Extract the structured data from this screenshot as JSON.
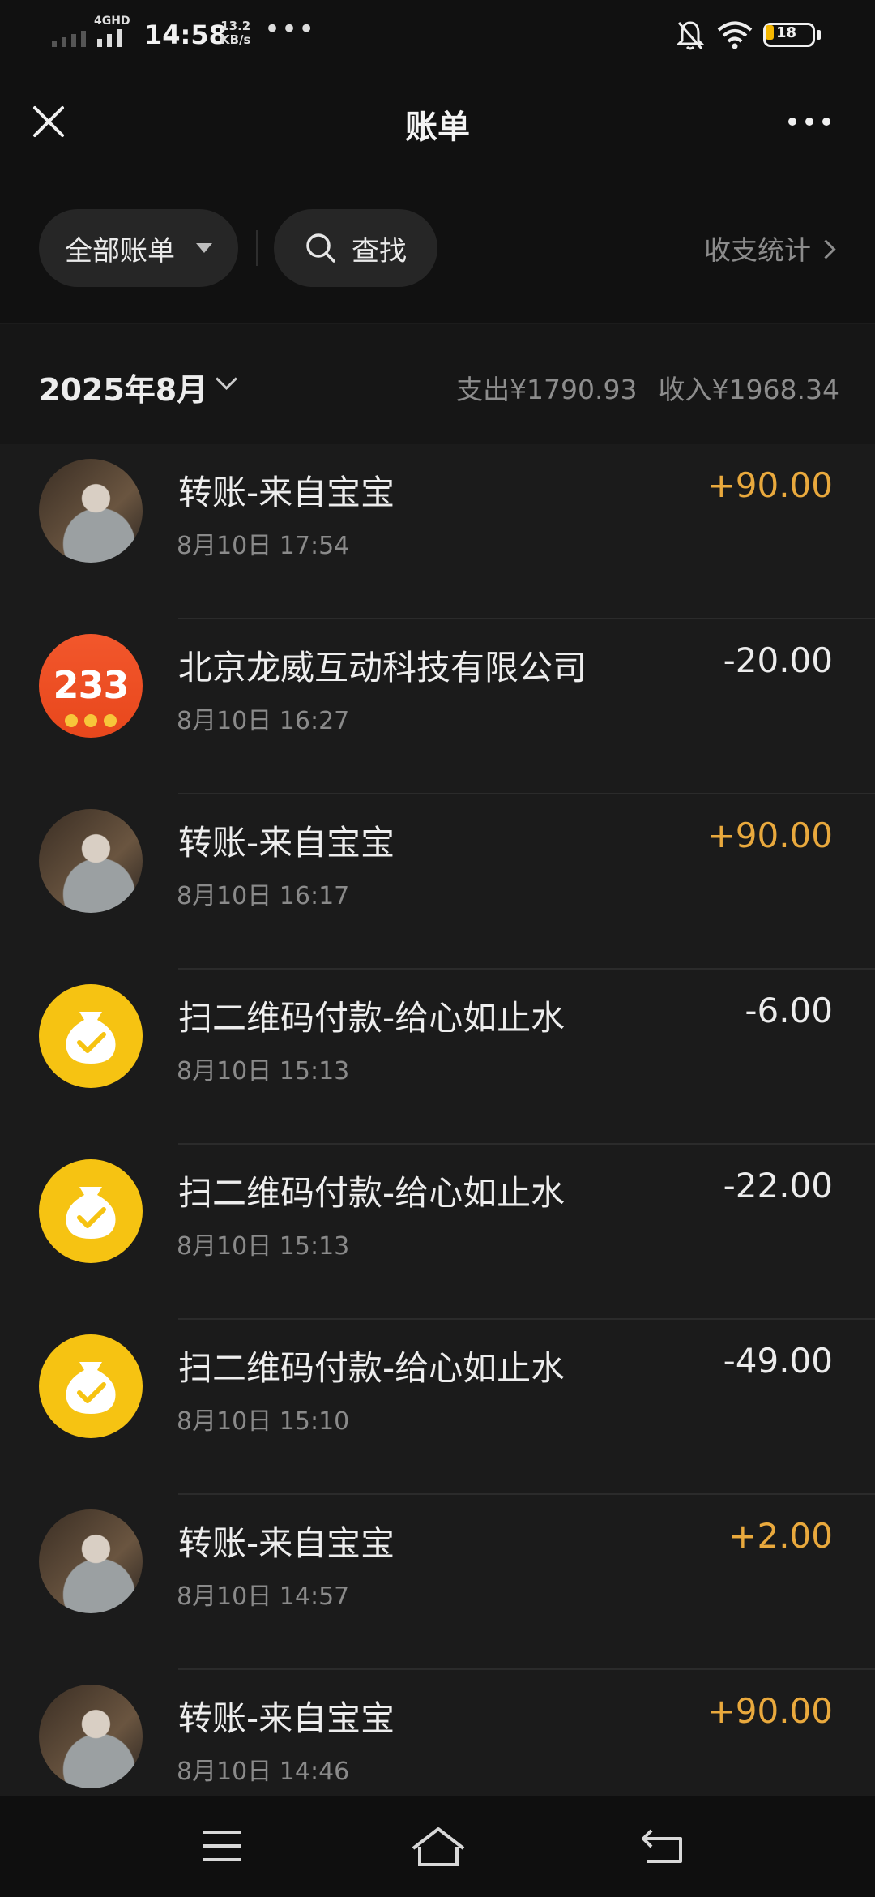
{
  "status_bar": {
    "network_type": "4GHD",
    "time": "14:58",
    "speed_value": "13.2",
    "speed_unit": "KB/s",
    "more": "•••",
    "battery_level": "18",
    "icons": [
      "signal-icon",
      "bell-off-icon",
      "wifi-icon",
      "battery-icon"
    ]
  },
  "header": {
    "title": "账单",
    "close_icon": "close-icon",
    "more_icon": "more-icon"
  },
  "filters": {
    "all_bills_label": "全部账单",
    "search_label": "查找",
    "stats_label": "收支统计"
  },
  "month": {
    "label": "2025年8月",
    "expense": "支出¥1790.93",
    "income": "收入¥1968.34"
  },
  "transactions": [
    {
      "title": "转账-来自宝宝",
      "time": "8月10日  17:54",
      "amount": "+90.00",
      "type": "income",
      "avatar": "photo"
    },
    {
      "title": "北京龙威互动科技有限公司",
      "time": "8月10日  16:27",
      "amount": "-20.00",
      "type": "expense",
      "avatar": "233",
      "avatar_text": "233"
    },
    {
      "title": "转账-来自宝宝",
      "time": "8月10日  16:17",
      "amount": "+90.00",
      "type": "income",
      "avatar": "photo"
    },
    {
      "title": "扫二维码付款-给心如止水",
      "time": "8月10日  15:13",
      "amount": "-6.00",
      "type": "expense",
      "avatar": "money-bag"
    },
    {
      "title": "扫二维码付款-给心如止水",
      "time": "8月10日  15:13",
      "amount": "-22.00",
      "type": "expense",
      "avatar": "money-bag"
    },
    {
      "title": "扫二维码付款-给心如止水",
      "time": "8月10日  15:10",
      "amount": "-49.00",
      "type": "expense",
      "avatar": "money-bag"
    },
    {
      "title": "转账-来自宝宝",
      "time": "8月10日  14:57",
      "amount": "+2.00",
      "type": "income",
      "avatar": "photo"
    },
    {
      "title": "转账-来自宝宝",
      "time": "8月10日  14:46",
      "amount": "+90.00",
      "type": "income",
      "avatar": "photo"
    }
  ],
  "colors": {
    "background": "#111111",
    "income": "#e9a93d",
    "pill": "#262626",
    "money_bag": "#f6c312",
    "app_233": "#f2572c"
  },
  "nav_bar": {
    "icons": [
      "menu-icon",
      "home-icon",
      "back-icon"
    ]
  }
}
